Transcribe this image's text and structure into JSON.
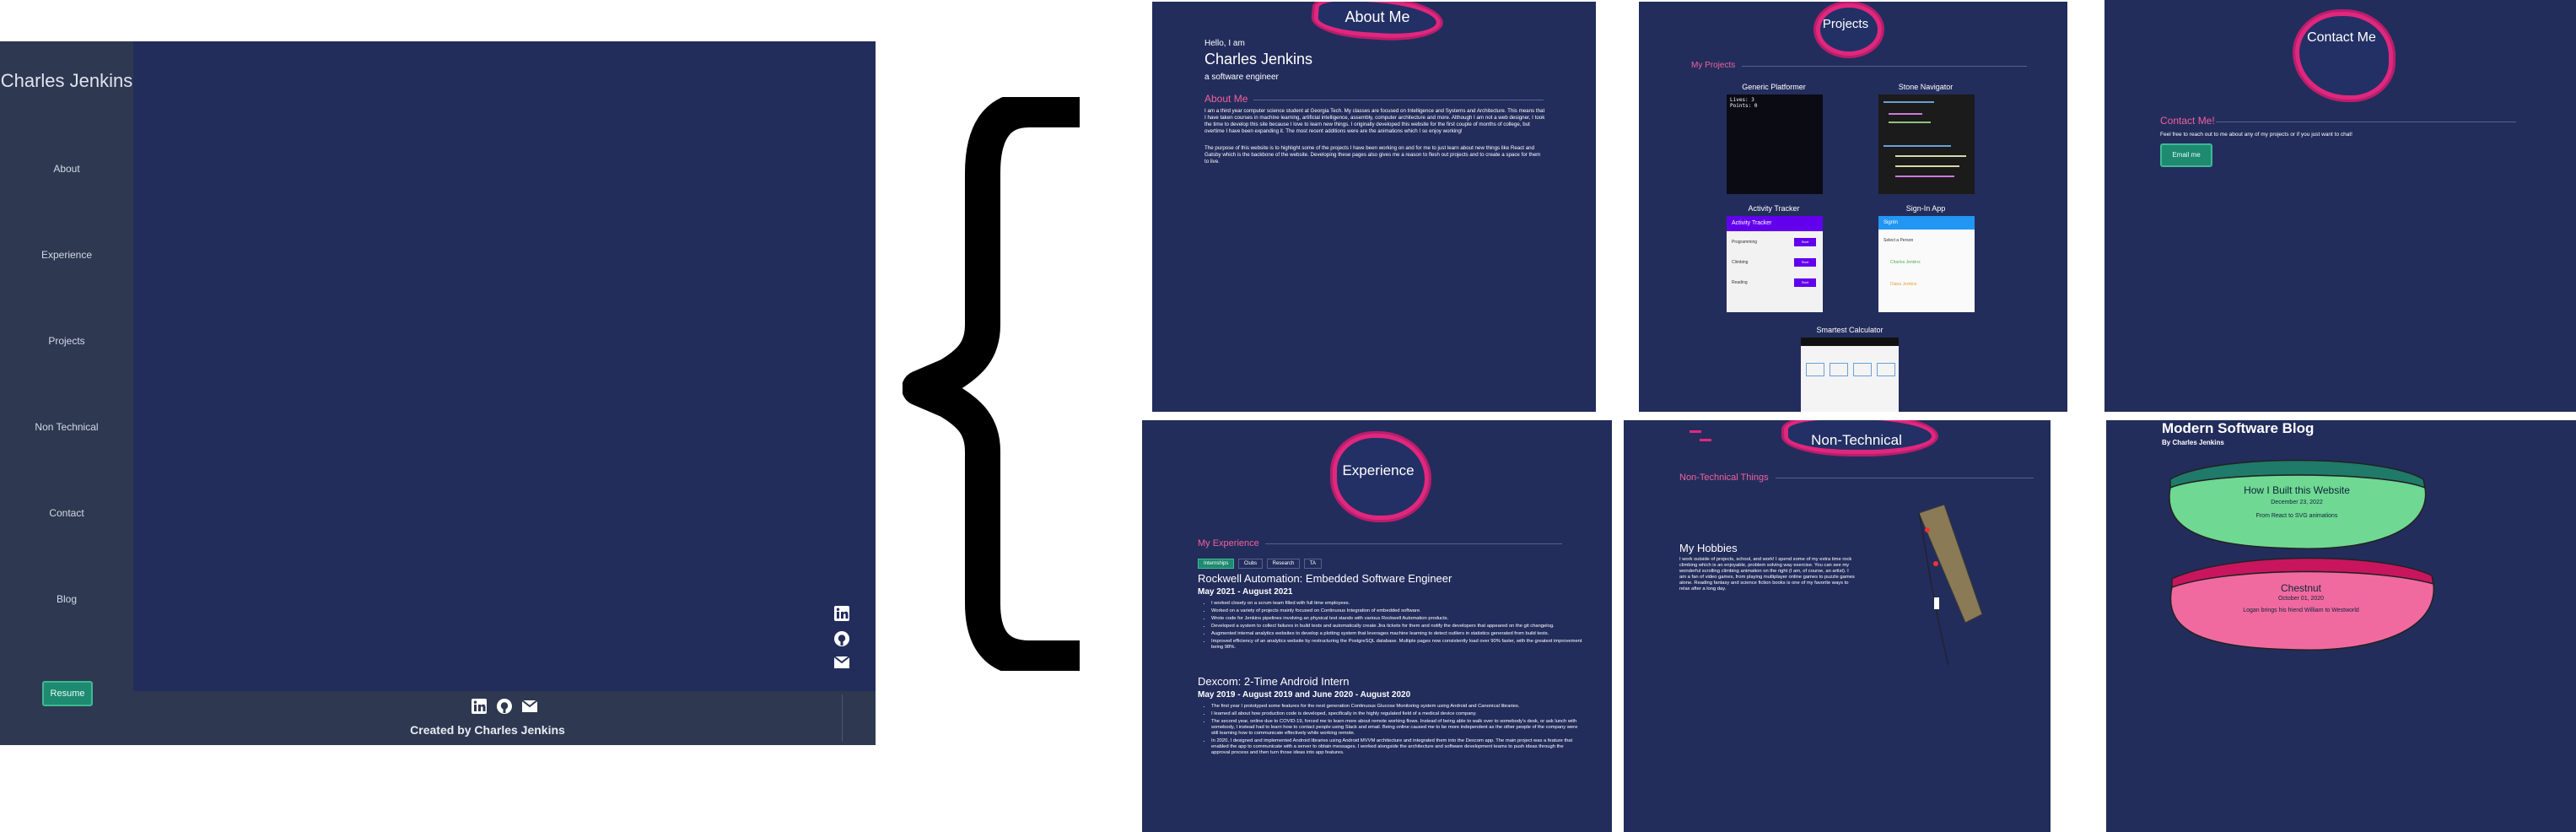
{
  "main": {
    "site_name": "Charles Jenkins",
    "nav": [
      "About",
      "Experience",
      "Projects",
      "Non Technical",
      "Contact",
      "Blog"
    ],
    "resume_label": "Resume",
    "footer_credit": "Created by Charles Jenkins",
    "social_icons": [
      "linkedin-icon",
      "github-icon",
      "mail-icon"
    ]
  },
  "about": {
    "tab_title": "About Me",
    "greeting": "Hello, I am",
    "name": "Charles Jenkins",
    "tagline": "a software engineer",
    "section_title": "About Me",
    "para1": "I am a third year computer science student at Georgia Tech. My classes are focused on Intelligence and Systems and Architecture. This means that I have taken courses in machine learning, artificial intelligence, assembly, computer architecture and more. Although I am not a web designer, I took the time to develop this site because I love to learn new things. I originally developed this website for the first couple of months of college, but overtime I have been expanding it. The most recent additions were are the animations which I so enjoy working!",
    "para2": "The purpose of this website is to highlight some of the projects I have been working on and for me to just learn about new things like React and Gatsby which is the backbone of the website. Developing these pages also gives me a reason to flesh out projects and to create a space for them to live."
  },
  "projects": {
    "tab_title": "Projects",
    "section_title": "My Projects",
    "items": [
      "Generic Platformer",
      "Stone Navigator",
      "Activity Tracker",
      "Sign-In App",
      "Smartest Calculator"
    ],
    "platformer_text": "Lives: 3\nPoints: 0",
    "tracker_header": "Activity Tracker",
    "tracker_rows": [
      "Programming",
      "Climbing",
      "Reading"
    ],
    "tracker_btn": "Start",
    "signin_header": "SignIn",
    "signin_rows": [
      "Select a Person",
      "Charles Jenkins",
      "Diana Jenkins"
    ]
  },
  "contact": {
    "tab_title": "Contact Me",
    "section_title": "Contact Me!",
    "body": "Feel free to reach out to me about any of my projects or if you just want to chat!",
    "button": "Email me"
  },
  "experience": {
    "tab_title": "Experience",
    "section_title": "My Experience",
    "tabs": [
      "Internships",
      "Clubs",
      "Research",
      "TA"
    ],
    "jobs": [
      {
        "title": "Rockwell Automation: Embedded Software Engineer",
        "dates": "May 2021 - August 2021",
        "bullets": [
          "I worked closely on a scrum team filled with full time employees.",
          "Worked on a variety of projects mainly focused on Continuous Integration of embedded software.",
          "Wrote code for Jenkins pipelines involving an physical test stands with various Rockwell Automation products.",
          "Developed a system to collect failures in build tests and automatically create Jira tickets for them and notify the developers that appeared on the git changelog.",
          "Augmented internal analytics websites to develop a plotting system that leverages machine learning to detect outliers in statistics generated from build tests.",
          "Improved efficiency of an analytics website by restructuring the PostgreSQL database. Multiple pages now consistently load over 90% faster, with the greatest improvement being 98%."
        ]
      },
      {
        "title": "Dexcom: 2-Time Android Intern",
        "dates": "May 2019 - August 2019 and June 2020 - August 2020",
        "bullets": [
          "The first year I prototyped some features for the next generation Continuous Glucose Monitoring system using Android and Canonical libraries.",
          "I learned all about how production code is developed, specifically in the highly regulated field of a medical device company.",
          "The second year, online due to COVID-19, forced me to learn more about remote working flows. Instead of being able to walk over to somebody's desk, or ask lunch with somebody, I instead had to learn how to contact people using Slack and email. Being online caused me to be more independent as the other people of the company were still learning how to communicate effectively while working remote.",
          "In 2020, I designed and implemented Android libraries using Android MVVM architecture and integrated them into the Dexcom app. The main project was a feature that enabled the app to communicate with a server to obtain messages. I worked alongside the architecture and software development teams to push ideas through the approval process and then turn those ideas into app features."
        ]
      }
    ]
  },
  "nontech": {
    "tab_title": "Non-Technical",
    "section_title": "Non-Technical Things",
    "hobbies_title": "My Hobbies",
    "hobbies_text": "I work outside of projects, school, and work! I spend some of my extra time rock climbing which is an enjoyable, problem solving way exercise. You can see my wonderful scrolling climbing animation on the right (I am, of course, an artist). I am a fan of video games, from playing multiplayer online games to puzzle games alone. Reading fantasy and science fiction books is one of my favorite ways to relax after a long day."
  },
  "blog": {
    "title": "Modern Software Blog",
    "author": "By Charles Jenkins",
    "posts": [
      {
        "title": "How I Built this Website",
        "date": "December 23, 2022",
        "desc": "From React to SVG animations"
      },
      {
        "title": "Chestnut",
        "date": "October 01, 2020",
        "desc": "Logan brings his friend William to Westworld"
      }
    ]
  },
  "colors": {
    "navy": "#232d5c",
    "sidebar": "#2e3850",
    "pink": "#f0609a",
    "blog_green": "#6fd893",
    "blog_pink": "#f06aa0"
  }
}
